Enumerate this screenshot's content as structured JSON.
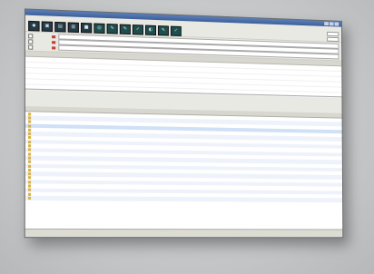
{
  "toolbar": {
    "buttons": [
      {
        "name": "new-icon",
        "glyph": "◆"
      },
      {
        "name": "open-icon",
        "glyph": "▣"
      },
      {
        "name": "save-icon",
        "glyph": "▤"
      },
      {
        "name": "print-icon",
        "glyph": "▥"
      },
      {
        "name": "stop-icon",
        "glyph": "■"
      },
      {
        "name": "search-icon",
        "glyph": "◎"
      },
      {
        "name": "edit-icon",
        "glyph": "✎"
      },
      {
        "name": "tools-icon",
        "glyph": "✎"
      },
      {
        "name": "settings-icon",
        "glyph": "✓"
      },
      {
        "name": "filter-icon",
        "glyph": "◐"
      },
      {
        "name": "help-icon",
        "glyph": "✎"
      },
      {
        "name": "exit-icon",
        "glyph": "✓"
      }
    ]
  }
}
